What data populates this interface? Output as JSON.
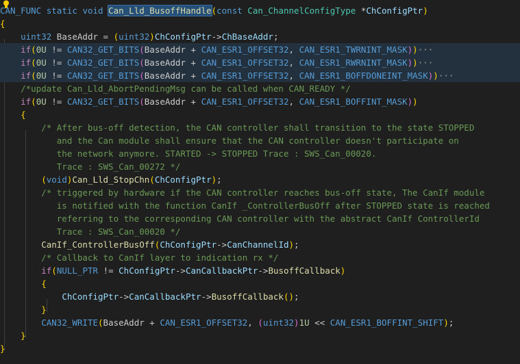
{
  "lines": [
    {
      "text": "CAN_FUNC static void Can_Lld_BusoffHandle(const Can_ChannelConfigType *ChConfigPtr)",
      "hl": false
    },
    {
      "text": "{",
      "hl": false
    },
    {
      "text": "    uint32 BaseAddr = (uint32)ChConfigPtr->ChBaseAddr;",
      "hl": false
    },
    {
      "text": "    if(0U != CAN32_GET_BITS(BaseAddr + CAN_ESR1_OFFSET32, CAN_ESR1_TWRNINT_MASK))···",
      "hl": true
    },
    {
      "text": "    if(0U != CAN32_GET_BITS(BaseAddr + CAN_ESR1_OFFSET32, CAN_ESR1_RWRNINT_MASK))···",
      "hl": true
    },
    {
      "text": "    if(0U != CAN32_GET_BITS(BaseAddr + CAN_ESR1_OFFSET32, CAN_ESR1_BOFFDONEINT_MASK))···",
      "hl": true
    },
    {
      "text": "    /*update Can_Lld_AbortPendingMsg can be called when CAN_READY */",
      "hl": false
    },
    {
      "text": "    if(0U != CAN32_GET_BITS(BaseAddr + CAN_ESR1_OFFSET32, CAN_ESR1_BOFFINT_MASK))",
      "hl": false
    },
    {
      "text": "    {",
      "hl": false
    },
    {
      "text": "        /* After bus-off detection, the CAN controller shall transition to the state STOPPED",
      "hl": false
    },
    {
      "text": "           and the Can module shall ensure that the CAN controller doesn't participate on",
      "hl": false
    },
    {
      "text": "           the network anymore. STARTED -> STOPPED Trace : SWS_Can_00020.",
      "hl": false
    },
    {
      "text": "           Trace : SWS_Can_00272 */",
      "hl": false
    },
    {
      "text": "        (void)Can_Lld_StopChn(ChConfigPtr);",
      "hl": false
    },
    {
      "text": "        /* triggered by hardware if the CAN controller reaches bus-off state, The CanIf module",
      "hl": false
    },
    {
      "text": "           is notified with the function CanIf _ControllerBusOff after STOPPED state is reached",
      "hl": false
    },
    {
      "text": "           referring to the corresponding CAN controller with the abstract CanIf ControllerId",
      "hl": false
    },
    {
      "text": "           Trace : SWS_Can_00020 */",
      "hl": false
    },
    {
      "text": "        CanIf_ControllerBusOff(ChConfigPtr->CanChannelId);",
      "hl": false
    },
    {
      "text": "        /* Callback to CanIf layer to indication rx */",
      "hl": false
    },
    {
      "text": "        if(NULL_PTR != ChConfigPtr->CanCallbackPtr->BusoffCallback)",
      "hl": false
    },
    {
      "text": "        {",
      "hl": false
    },
    {
      "text": "            ChConfigPtr->CanCallbackPtr->BusoffCallback();",
      "hl": false
    },
    {
      "text": "        }",
      "hl": false
    },
    {
      "text": "        CAN32_WRITE(BaseAddr + CAN_ESR1_OFFSET32, (uint32)1U << CAN_ESR1_BOFFINT_SHIFT);",
      "hl": false
    },
    {
      "text": "    }",
      "hl": false
    },
    {
      "text": "}",
      "hl": false
    }
  ],
  "selected_word": "Can_Lld_BusoffHandle",
  "icons": {
    "gutter": "lightbulb-icon",
    "fold": "ellipsis-icon"
  },
  "colors": {
    "background": "#1f1f1f",
    "line_highlight": "#23303d",
    "selection": "#264f78"
  }
}
